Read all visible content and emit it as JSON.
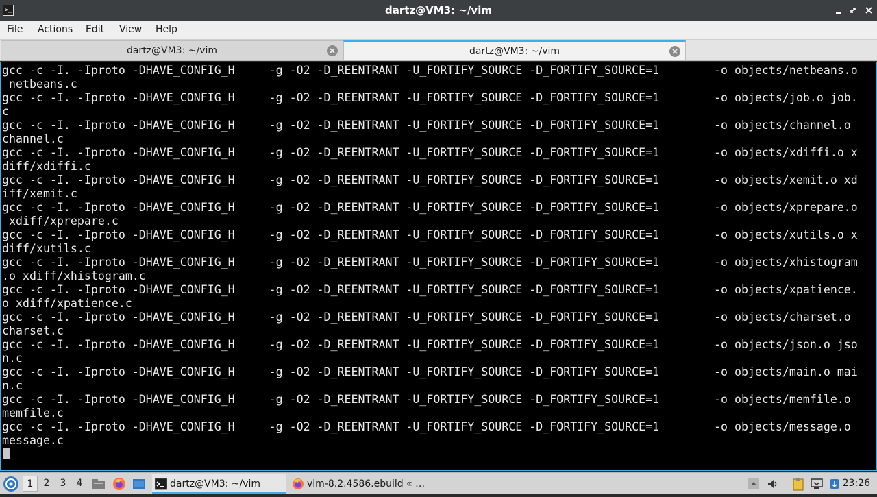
{
  "window": {
    "title": "dartz@VM3: ~/vim",
    "terminal_icon_glyph": ">_"
  },
  "menu": {
    "items": [
      "File",
      "Actions",
      "Edit",
      "View",
      "Help"
    ]
  },
  "tabs": [
    {
      "label": "dartz@VM3: ~/vim",
      "active": false
    },
    {
      "label": "dartz@VM3: ~/vim",
      "active": true
    }
  ],
  "terminal": {
    "lines": [
      "gcc -c -I. -Iproto -DHAVE_CONFIG_H     -g -O2 -D_REENTRANT -U_FORTIFY_SOURCE -D_FORTIFY_SOURCE=1        -o objects/netbeans.o",
      " netbeans.c",
      "gcc -c -I. -Iproto -DHAVE_CONFIG_H     -g -O2 -D_REENTRANT -U_FORTIFY_SOURCE -D_FORTIFY_SOURCE=1        -o objects/job.o job.",
      "c",
      "gcc -c -I. -Iproto -DHAVE_CONFIG_H     -g -O2 -D_REENTRANT -U_FORTIFY_SOURCE -D_FORTIFY_SOURCE=1        -o objects/channel.o",
      "channel.c",
      "gcc -c -I. -Iproto -DHAVE_CONFIG_H     -g -O2 -D_REENTRANT -U_FORTIFY_SOURCE -D_FORTIFY_SOURCE=1        -o objects/xdiffi.o x",
      "diff/xdiffi.c",
      "gcc -c -I. -Iproto -DHAVE_CONFIG_H     -g -O2 -D_REENTRANT -U_FORTIFY_SOURCE -D_FORTIFY_SOURCE=1        -o objects/xemit.o xd",
      "iff/xemit.c",
      "gcc -c -I. -Iproto -DHAVE_CONFIG_H     -g -O2 -D_REENTRANT -U_FORTIFY_SOURCE -D_FORTIFY_SOURCE=1        -o objects/xprepare.o",
      " xdiff/xprepare.c",
      "gcc -c -I. -Iproto -DHAVE_CONFIG_H     -g -O2 -D_REENTRANT -U_FORTIFY_SOURCE -D_FORTIFY_SOURCE=1        -o objects/xutils.o x",
      "diff/xutils.c",
      "gcc -c -I. -Iproto -DHAVE_CONFIG_H     -g -O2 -D_REENTRANT -U_FORTIFY_SOURCE -D_FORTIFY_SOURCE=1        -o objects/xhistogram",
      ".o xdiff/xhistogram.c",
      "gcc -c -I. -Iproto -DHAVE_CONFIG_H     -g -O2 -D_REENTRANT -U_FORTIFY_SOURCE -D_FORTIFY_SOURCE=1        -o objects/xpatience.",
      "o xdiff/xpatience.c",
      "gcc -c -I. -Iproto -DHAVE_CONFIG_H     -g -O2 -D_REENTRANT -U_FORTIFY_SOURCE -D_FORTIFY_SOURCE=1        -o objects/charset.o",
      "charset.c",
      "gcc -c -I. -Iproto -DHAVE_CONFIG_H     -g -O2 -D_REENTRANT -U_FORTIFY_SOURCE -D_FORTIFY_SOURCE=1        -o objects/json.o jso",
      "n.c",
      "gcc -c -I. -Iproto -DHAVE_CONFIG_H     -g -O2 -D_REENTRANT -U_FORTIFY_SOURCE -D_FORTIFY_SOURCE=1        -o objects/main.o mai",
      "n.c",
      "gcc -c -I. -Iproto -DHAVE_CONFIG_H     -g -O2 -D_REENTRANT -U_FORTIFY_SOURCE -D_FORTIFY_SOURCE=1        -o objects/memfile.o",
      "memfile.c",
      "gcc -c -I. -Iproto -DHAVE_CONFIG_H     -g -O2 -D_REENTRANT -U_FORTIFY_SOURCE -D_FORTIFY_SOURCE=1        -o objects/message.o",
      "message.c"
    ]
  },
  "taskbar": {
    "workspaces": [
      "1",
      "2",
      "3",
      "4"
    ],
    "active_workspace": "1",
    "tasks": [
      {
        "label": "dartz@VM3: ~/vim",
        "icon": "terminal-icon",
        "active": true
      },
      {
        "label": "vim-8.2.4586.ebuild « …",
        "icon": "firefox-icon",
        "active": false
      }
    ],
    "clock": "23:26"
  },
  "colors": {
    "accent": "#3daee9",
    "terminal_bg": "#000000",
    "terminal_fg": "#e8e8e8",
    "titlebar_bg": "#3c3f41"
  }
}
